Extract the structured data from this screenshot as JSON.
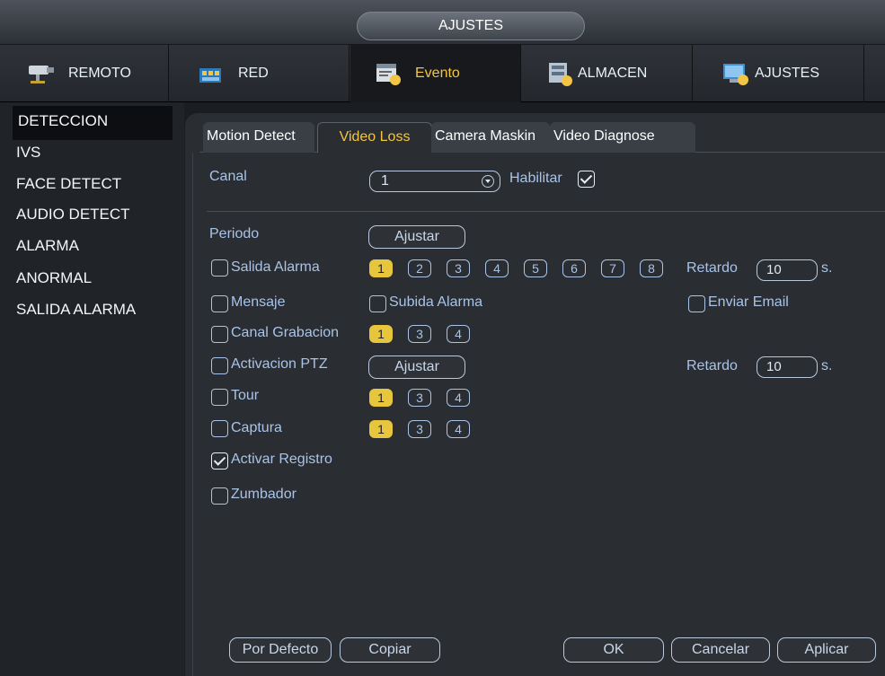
{
  "window": {
    "title": "AJUSTES"
  },
  "top_tabs": [
    {
      "label": "REMOTO",
      "icon": "camera-icon"
    },
    {
      "label": "RED",
      "icon": "network-icon"
    },
    {
      "label": "Evento",
      "icon": "event-icon",
      "active": true
    },
    {
      "label": "ALMACEN",
      "icon": "storage-icon"
    },
    {
      "label": "AJUSTES",
      "icon": "settings-icon"
    }
  ],
  "sidebar": {
    "items": [
      {
        "label": "DETECCION",
        "active": true
      },
      {
        "label": "IVS"
      },
      {
        "label": "FACE DETECT"
      },
      {
        "label": "AUDIO DETECT"
      },
      {
        "label": "ALARMA"
      },
      {
        "label": "ANORMAL"
      },
      {
        "label": "SALIDA ALARMA"
      }
    ]
  },
  "subtabs": [
    {
      "label": "Motion Detect"
    },
    {
      "label": "Video Loss",
      "active": true
    },
    {
      "label": "Camera Maskin"
    },
    {
      "label": "Video Diagnose"
    }
  ],
  "form": {
    "canal_label": "Canal",
    "canal_value": "1",
    "habilitar_label": "Habilitar",
    "habilitar_checked": true,
    "periodo_label": "Periodo",
    "ajustar_label": "Ajustar",
    "salida_alarma_label": "Salida Alarma",
    "salida_alarma_outputs": [
      "1",
      "2",
      "3",
      "4",
      "5",
      "6",
      "7",
      "8"
    ],
    "retardo_label": "Retardo",
    "retardo_value": "10",
    "seconds_unit": "s.",
    "mensaje_label": "Mensaje",
    "subida_alarma_label": "Subida Alarma",
    "enviar_email_label": "Enviar Email",
    "canal_grabacion_label": "Canal Grabacion",
    "channels": [
      "1",
      "3",
      "4"
    ],
    "activacion_ptz_label": "Activacion PTZ",
    "ptz_ajustar_label": "Ajustar",
    "ptz_retardo_label": "Retardo",
    "ptz_retardo_value": "10",
    "tour_label": "Tour",
    "captura_label": "Captura",
    "activar_registro_label": "Activar Registro",
    "activar_registro_checked": true,
    "zumbador_label": "Zumbador"
  },
  "footer": {
    "por_defecto": "Por Defecto",
    "copiar": "Copiar",
    "ok": "OK",
    "cancelar": "Cancelar",
    "aplicar": "Aplicar"
  },
  "colors": {
    "accent": "#f2c644",
    "label": "#a9c4e8",
    "selected_num": "#e7c53d"
  }
}
